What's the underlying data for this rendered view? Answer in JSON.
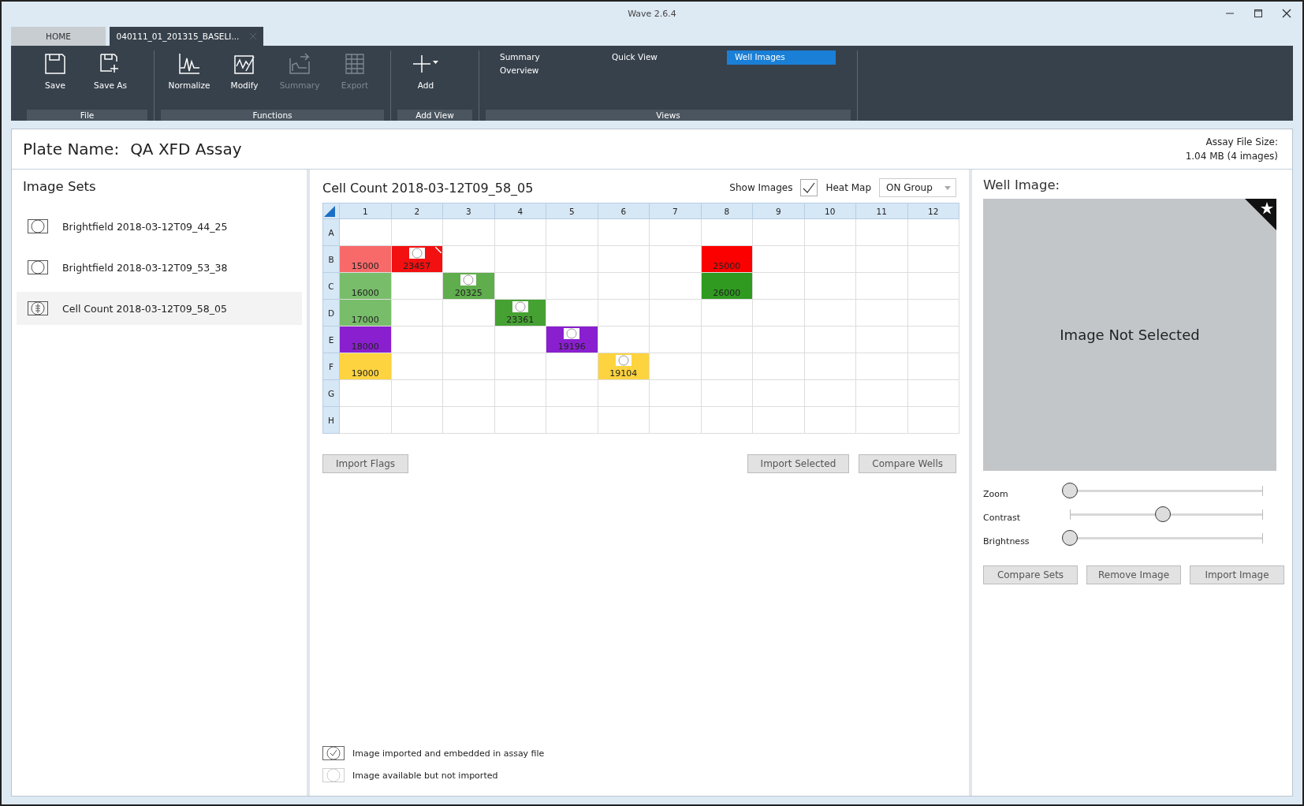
{
  "window": {
    "title": "Wave 2.6.4"
  },
  "tabs": [
    {
      "label": "HOME",
      "selected": false
    },
    {
      "label": "040111_01_201315_BASELI...",
      "selected": true
    }
  ],
  "ribbon": [
    {
      "label": "File",
      "items": [
        {
          "label": "Save",
          "disabled": false
        },
        {
          "label": "Save As",
          "disabled": false
        }
      ]
    },
    {
      "label": "Functions",
      "items": [
        {
          "label": "Normalize",
          "disabled": false
        },
        {
          "label": "Modify",
          "disabled": false
        },
        {
          "label": "Summary",
          "disabled": true
        },
        {
          "label": "Export",
          "disabled": true
        }
      ]
    },
    {
      "label": "Add View",
      "items": [
        {
          "label": "Add",
          "disabled": false
        }
      ]
    }
  ],
  "views": {
    "label": "Views",
    "items": [
      {
        "label": "Summary Overview",
        "selected": false
      },
      {
        "label": "Quick View",
        "selected": false
      },
      {
        "label": "Well Images",
        "selected": true
      }
    ]
  },
  "plate": {
    "label": "Plate Name:",
    "name": "QA XFD Assay",
    "size_label": "Assay File Size:",
    "size": "1.04 MB  (4 images)"
  },
  "image_sets": {
    "title": "Image Sets",
    "items": [
      {
        "label": "Brightfield 2018-03-12T09_44_25",
        "kind": "brightfield",
        "selected": false
      },
      {
        "label": "Brightfield 2018-03-12T09_53_38",
        "kind": "brightfield",
        "selected": false
      },
      {
        "label": "Cell Count 2018-03-12T09_58_05",
        "kind": "cellcount",
        "selected": true
      }
    ]
  },
  "center": {
    "title": "Cell Count 2018-03-12T09_58_05",
    "show_images_label": "Show Images",
    "show_images": true,
    "heat_map_label": "Heat Map",
    "heat_map": "ON Group",
    "columns": [
      "1",
      "2",
      "3",
      "4",
      "5",
      "6",
      "7",
      "8",
      "9",
      "10",
      "11",
      "12"
    ],
    "rows": [
      {
        "label": "A",
        "cells": [
          null,
          null,
          null,
          null,
          null,
          null,
          null,
          null,
          null,
          null,
          null,
          null
        ]
      },
      {
        "label": "B",
        "cells": [
          {
            "value": "15000",
            "color": "#f86a6a",
            "image": false,
            "flagged": false
          },
          {
            "value": "23457",
            "color": "#f21010",
            "image": true,
            "flagged": true
          },
          null,
          null,
          null,
          null,
          null,
          {
            "value": "25000",
            "color": "#fc0000",
            "image": false,
            "flagged": false
          },
          null,
          null,
          null,
          null
        ]
      },
      {
        "label": "C",
        "cells": [
          {
            "value": "16000",
            "color": "#78bd6a",
            "image": false,
            "flagged": false
          },
          null,
          {
            "value": "20325",
            "color": "#5fad4c",
            "image": true,
            "flagged": false
          },
          null,
          null,
          null,
          null,
          {
            "value": "26000",
            "color": "#2f9a1f",
            "image": false,
            "flagged": false
          },
          null,
          null,
          null,
          null
        ]
      },
      {
        "label": "D",
        "cells": [
          {
            "value": "17000",
            "color": "#78bd6a",
            "image": false,
            "flagged": false
          },
          null,
          null,
          {
            "value": "23361",
            "color": "#46a133",
            "image": true,
            "flagged": false
          },
          null,
          null,
          null,
          null,
          null,
          null,
          null,
          null
        ]
      },
      {
        "label": "E",
        "cells": [
          {
            "value": "18000",
            "color": "#8a1fcf",
            "image": false,
            "flagged": false
          },
          null,
          null,
          null,
          {
            "value": "19196",
            "color": "#8a1fcf",
            "image": true,
            "flagged": false
          },
          null,
          null,
          null,
          null,
          null,
          null,
          null
        ]
      },
      {
        "label": "F",
        "cells": [
          {
            "value": "19000",
            "color": "#fdd33f",
            "image": false,
            "flagged": false
          },
          null,
          null,
          null,
          null,
          {
            "value": "19104",
            "color": "#fdd33f",
            "image": true,
            "flagged": false
          },
          null,
          null,
          null,
          null,
          null,
          null
        ]
      },
      {
        "label": "G",
        "cells": [
          null,
          null,
          null,
          null,
          null,
          null,
          null,
          null,
          null,
          null,
          null,
          null
        ]
      },
      {
        "label": "H",
        "cells": [
          null,
          null,
          null,
          null,
          null,
          null,
          null,
          null,
          null,
          null,
          null,
          null
        ]
      }
    ],
    "left_buttons": [
      "Import Flags"
    ],
    "right_buttons": [
      "Import Selected",
      "Compare Wells"
    ],
    "legend": [
      {
        "label": "Image imported and embedded in assay file",
        "kind": "imported"
      },
      {
        "label": "Image available but not imported",
        "kind": "available"
      }
    ]
  },
  "well_image": {
    "title": "Well Image:",
    "placeholder": "Image Not Selected",
    "starred": true,
    "sliders": [
      {
        "label": "Zoom",
        "level": 0
      },
      {
        "label": "Contrast",
        "level": 0.5
      },
      {
        "label": "Brightness",
        "level": 0
      }
    ],
    "buttons": [
      "Compare Sets",
      "Remove Image",
      "Import Image"
    ]
  }
}
